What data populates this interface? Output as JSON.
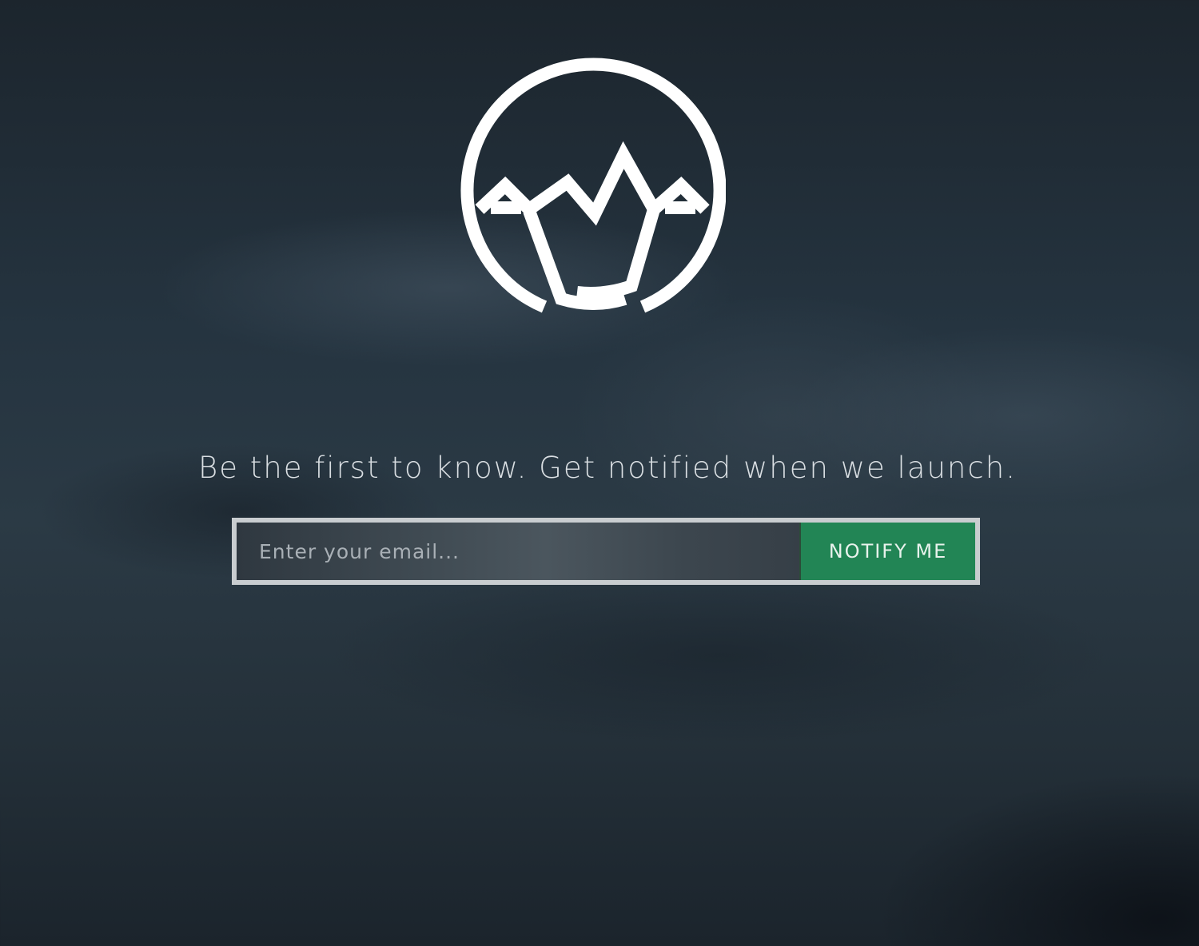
{
  "logo": {
    "icon": "mountain-circle-logo",
    "color": "#ffffff"
  },
  "hero": {
    "tagline": "Be the first to know. Get notified when we launch."
  },
  "signup": {
    "email_placeholder": "Enter your email...",
    "email_value": "",
    "button_label": "NOTIFY ME",
    "button_color": "#228555",
    "border_color": "#c9cdd0"
  }
}
